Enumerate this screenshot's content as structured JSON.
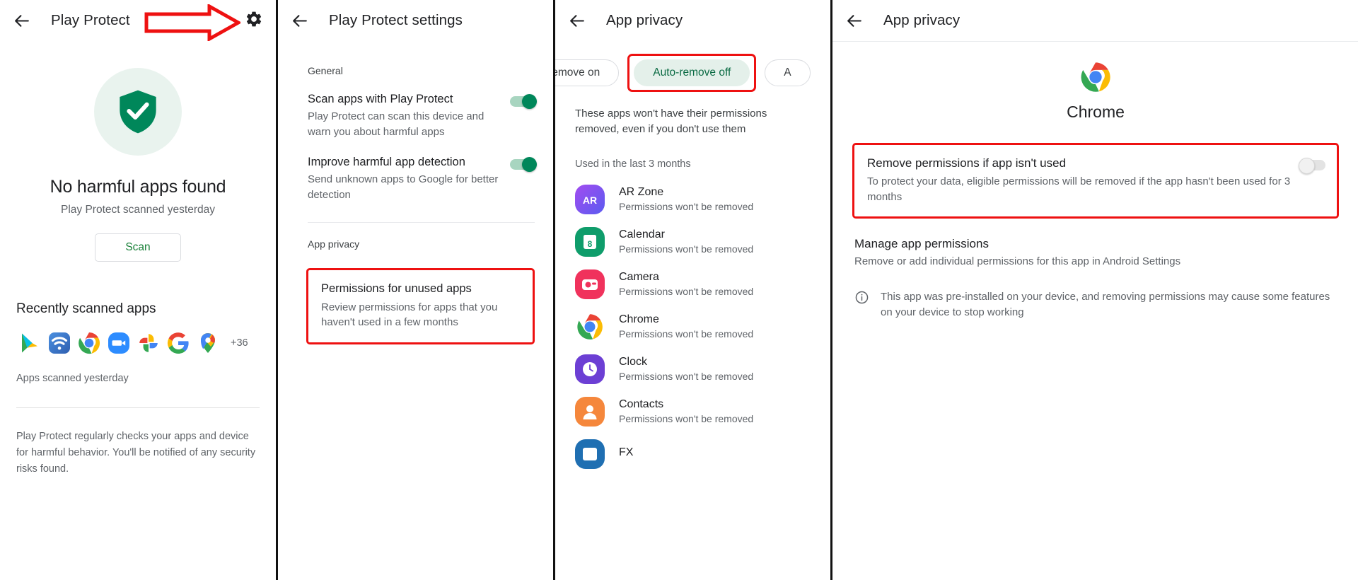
{
  "panel1": {
    "appbar": {
      "title": "Play Protect",
      "back_icon": "back-arrow-icon",
      "settings_icon": "gear-icon"
    },
    "annotation": {
      "arrow_icon": "red-arrow-annotation",
      "color": "#ee1111"
    },
    "hero": {
      "shield_icon": "shield-check-icon",
      "title": "No harmful apps found",
      "subtitle": "Play Protect scanned yesterday",
      "scan_button": "Scan"
    },
    "recent": {
      "section_title": "Recently scanned apps",
      "apps": [
        {
          "name": "Google Play Store",
          "icon": "play-store-icon"
        },
        {
          "name": "Wi-Fi",
          "icon": "wifi-app-icon"
        },
        {
          "name": "Chrome",
          "icon": "chrome-icon"
        },
        {
          "name": "Zoom",
          "icon": "zoom-icon"
        },
        {
          "name": "Google Photos",
          "icon": "photos-icon"
        },
        {
          "name": "Google",
          "icon": "google-g-icon"
        },
        {
          "name": "Maps",
          "icon": "maps-pin-icon"
        }
      ],
      "more_count": "+36",
      "scanned_note": "Apps scanned yesterday"
    },
    "footer": "Play Protect regularly checks your apps and device for harmful behavior. You'll be notified of any security risks found."
  },
  "panel2": {
    "appbar": {
      "title": "Play Protect settings",
      "back_icon": "back-arrow-icon"
    },
    "general_label": "General",
    "options": [
      {
        "title": "Scan apps with Play Protect",
        "desc": "Play Protect can scan this device and warn you about harmful apps",
        "toggle": "on"
      },
      {
        "title": "Improve harmful app detection",
        "desc": "Send unknown apps to Google for better detection",
        "toggle": "on"
      }
    ],
    "privacy_label": "App privacy",
    "highlighted": {
      "title": "Permissions for unused apps",
      "desc": "Review permissions for apps that you haven't used in a few months",
      "highlight_color": "#ee1111"
    }
  },
  "panel3": {
    "appbar": {
      "title": "App privacy",
      "back_icon": "back-arrow-icon"
    },
    "chips": [
      {
        "label": "Auto-remove on",
        "selected": false,
        "highlighted": false
      },
      {
        "label": "Auto-remove off",
        "selected": true,
        "highlighted": true
      },
      {
        "label": "A",
        "selected": false,
        "highlighted": false
      }
    ],
    "note": "These apps won't have their permissions removed, even if you don't use them",
    "list_header": "Used in the last 3 months",
    "apps": [
      {
        "name": "AR Zone",
        "status": "Permissions won't be removed",
        "icon": "ar-zone-icon"
      },
      {
        "name": "Calendar",
        "status": "Permissions won't be removed",
        "icon": "calendar-icon"
      },
      {
        "name": "Camera",
        "status": "Permissions won't be removed",
        "icon": "camera-icon"
      },
      {
        "name": "Chrome",
        "status": "Permissions won't be removed",
        "icon": "chrome-icon"
      },
      {
        "name": "Clock",
        "status": "Permissions won't be removed",
        "icon": "clock-icon"
      },
      {
        "name": "Contacts",
        "status": "Permissions won't be removed",
        "icon": "contacts-icon"
      },
      {
        "name": "FX",
        "status": "",
        "icon": "fx-icon"
      }
    ]
  },
  "panel4": {
    "appbar": {
      "title": "App privacy",
      "back_icon": "back-arrow-icon"
    },
    "app": {
      "name": "Chrome",
      "icon": "chrome-icon"
    },
    "highlighted": {
      "title": "Remove permissions if app isn't used",
      "desc": "To protect your data, eligible permissions will be removed if the app hasn't been used for 3 months",
      "toggle": "off",
      "highlight_color": "#ee1111"
    },
    "manage": {
      "title": "Manage app permissions",
      "desc": "Remove or add individual permissions for this app in Android Settings"
    },
    "info": {
      "icon": "info-circle-icon",
      "text": "This app was pre-installed on your device, and removing permissions may cause some features on your device to stop working"
    }
  }
}
